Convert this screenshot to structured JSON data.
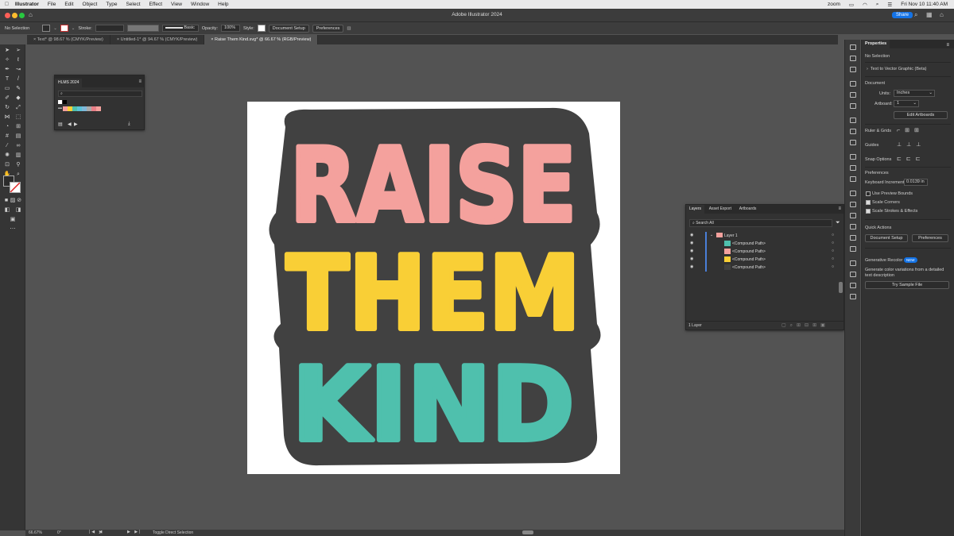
{
  "menubar": {
    "app": "Illustrator",
    "items": [
      "File",
      "Edit",
      "Object",
      "Type",
      "Select",
      "Effect",
      "View",
      "Window",
      "Help"
    ],
    "zoom": "zoom",
    "datetime": "Fri Nov 10  11:40 AM"
  },
  "window": {
    "title": "Adobe Illustrator 2024",
    "share": "Share"
  },
  "control": {
    "selection": "No Selection",
    "stroke_label": "Stroke:",
    "brush": "Basic",
    "opacity_label": "Opacity:",
    "opacity": "100%",
    "style_label": "Style:",
    "doc_setup": "Document Setup",
    "preferences": "Preferences"
  },
  "tabs": [
    "Text* @ 98.67 % (CMYK/Preview)",
    "Untitled-1* @ 94.67 % (CMYK/Preview)",
    "Raise Them Kind.svg* @ 66.67 % (RGB/Preview)"
  ],
  "artwork": {
    "lines": [
      "RAISE",
      "THEM",
      "KIND"
    ],
    "colors": {
      "raise": "#f4a19d",
      "them": "#f9cf36",
      "kind": "#4fc0ad",
      "outline": "#414141"
    }
  },
  "swatches": {
    "title": "HLMS 2024",
    "search_placeholder": "",
    "colors": [
      "#ffffff",
      "#000000",
      "#f4a19d",
      "#f9cf36",
      "#4fc0ad",
      "#5bc2d8",
      "#7fb8d9",
      "#aaaaaa",
      "#e87f88",
      "#f4a19d"
    ]
  },
  "layers": {
    "tabs": [
      "Layers",
      "Asset Export",
      "Artboards"
    ],
    "search": "Search All",
    "layer": "Layer 1",
    "paths": [
      "<Compound Path>",
      "<Compound Path>",
      "<Compound Path>",
      "<Compound Path>"
    ],
    "footer": "1 Layer"
  },
  "properties": {
    "title": "Properties",
    "selection": "No Selection",
    "t2v": "Text to Vector Graphic (Beta)",
    "document": "Document",
    "units_label": "Units:",
    "units": "Inches",
    "artboard_label": "Artboard:",
    "artboard": "1",
    "edit_artboards": "Edit Artboards",
    "ruler_grids": "Ruler & Grids",
    "guides": "Guides",
    "snap": "Snap Options",
    "prefs": "Preferences",
    "keyboard_inc_label": "Keyboard Increment:",
    "keyboard_inc": "0.0139 in",
    "use_preview": "Use Preview Bounds",
    "scale_corners": "Scale Corners",
    "scale_strokes": "Scale Strokes & Effects",
    "quick_actions": "Quick Actions",
    "doc_setup": "Document Setup",
    "preferences": "Preferences",
    "gen_recolor": "Generative Recolor",
    "new": "NEW",
    "gen_desc": "Generate color variations from a detailed text description",
    "try_sample": "Try Sample File"
  },
  "status": {
    "zoom": "66.67%",
    "rotation": "0°",
    "artboard": "1",
    "tool": "Toggle Direct Selection"
  }
}
